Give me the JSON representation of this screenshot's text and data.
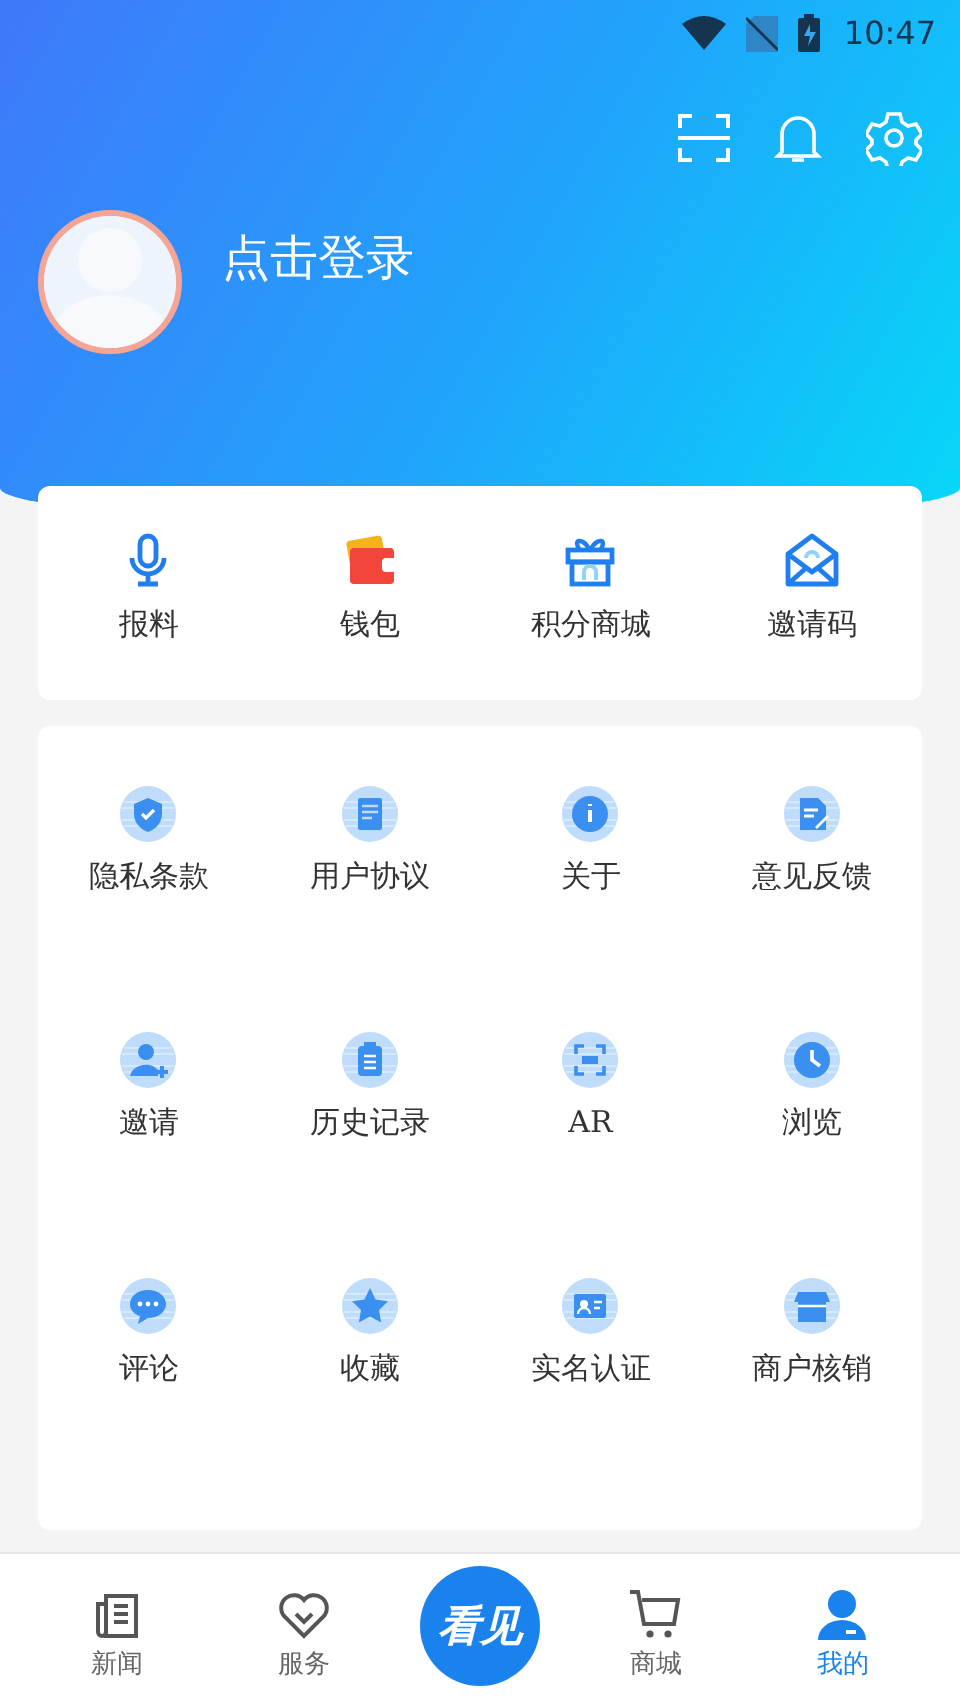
{
  "status_bar": {
    "time": "10:47"
  },
  "profile": {
    "login_prompt": "点击登录"
  },
  "quick_actions": [
    {
      "label": "报料"
    },
    {
      "label": "钱包"
    },
    {
      "label": "积分商城"
    },
    {
      "label": "邀请码"
    }
  ],
  "menu_items": [
    {
      "label": "隐私条款"
    },
    {
      "label": "用户协议"
    },
    {
      "label": "关于"
    },
    {
      "label": "意见反馈"
    },
    {
      "label": "邀请"
    },
    {
      "label": "历史记录"
    },
    {
      "label": "AR"
    },
    {
      "label": "浏览"
    },
    {
      "label": "评论"
    },
    {
      "label": "收藏"
    },
    {
      "label": "实名认证"
    },
    {
      "label": "商户核销"
    }
  ],
  "bottom_nav": {
    "logo_text": "看见",
    "tabs": [
      {
        "label": "新闻",
        "selected": false
      },
      {
        "label": "服务",
        "selected": false
      },
      {
        "label": "商城",
        "selected": false
      },
      {
        "label": "我的",
        "selected": true
      }
    ]
  }
}
